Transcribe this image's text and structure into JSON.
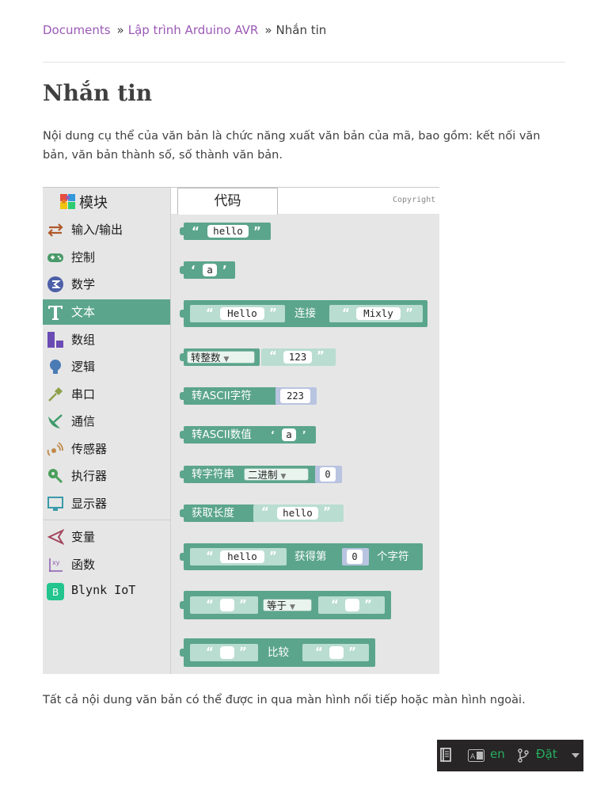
{
  "breadcrumb": {
    "home": "Documents",
    "parent": "Lập trình Arduino AVR",
    "current": "Nhắn tin",
    "sep": "»"
  },
  "title": "Nhắn tin",
  "intro": "Nội dung cụ thể của văn bản là chức năng xuất văn bản của mã, bao gồm: kết nối văn bản, văn bản thành số, số thành văn bản.",
  "outro": "Tất cả nội dung văn bản có thể được in qua màn hình nối tiếp hoặc màn hình ngoài.",
  "mixly": {
    "category_header": "模块",
    "code_tab": "代码",
    "copyright": "Copyright",
    "categories": [
      {
        "label": "输入/输出",
        "icon": "io-arrows-icon"
      },
      {
        "label": "控制",
        "icon": "gamepad-icon"
      },
      {
        "label": "数学",
        "icon": "math-icon"
      },
      {
        "label": "文本",
        "icon": "text-t-icon"
      },
      {
        "label": "数组",
        "icon": "array-blocks-icon"
      },
      {
        "label": "逻辑",
        "icon": "bulb-icon"
      },
      {
        "label": "串口",
        "icon": "usb-plug-icon"
      },
      {
        "label": "通信",
        "icon": "satellite-icon"
      },
      {
        "label": "传感器",
        "icon": "sensor-icon"
      },
      {
        "label": "执行器",
        "icon": "actuator-icon"
      },
      {
        "label": "显示器",
        "icon": "monitor-icon"
      },
      {
        "label": "变量",
        "icon": "variable-icon"
      },
      {
        "label": "函数",
        "icon": "function-icon"
      },
      {
        "label": "Blynk IoT",
        "icon": "blynk-icon"
      }
    ],
    "blocks": {
      "hello": "hello",
      "char_a": "a",
      "join_left": "Hello",
      "join_label": "连接",
      "join_right": "Mixly",
      "to_int": "转整数",
      "num_123": "123",
      "to_ascii_char": "转ASCII字符",
      "num_223": "223",
      "to_ascii_val": "转ASCII数值",
      "char_a2": "a",
      "to_string": "转字符串",
      "binary": "二进制",
      "zero": "0",
      "get_length": "获取长度",
      "hello2": "hello",
      "hello3": "hello",
      "get_nth": "获得第",
      "zero2": "0",
      "nth_char": "个字符",
      "equals": "等于",
      "compare": "比较"
    }
  },
  "version_switcher": {
    "lang": "en",
    "version": "Đặt"
  },
  "colors": {
    "link": "#9b59b6",
    "block_green": "#5ba58c",
    "text_light": "#b9ddd0",
    "rtd_green": "#27ae60"
  }
}
